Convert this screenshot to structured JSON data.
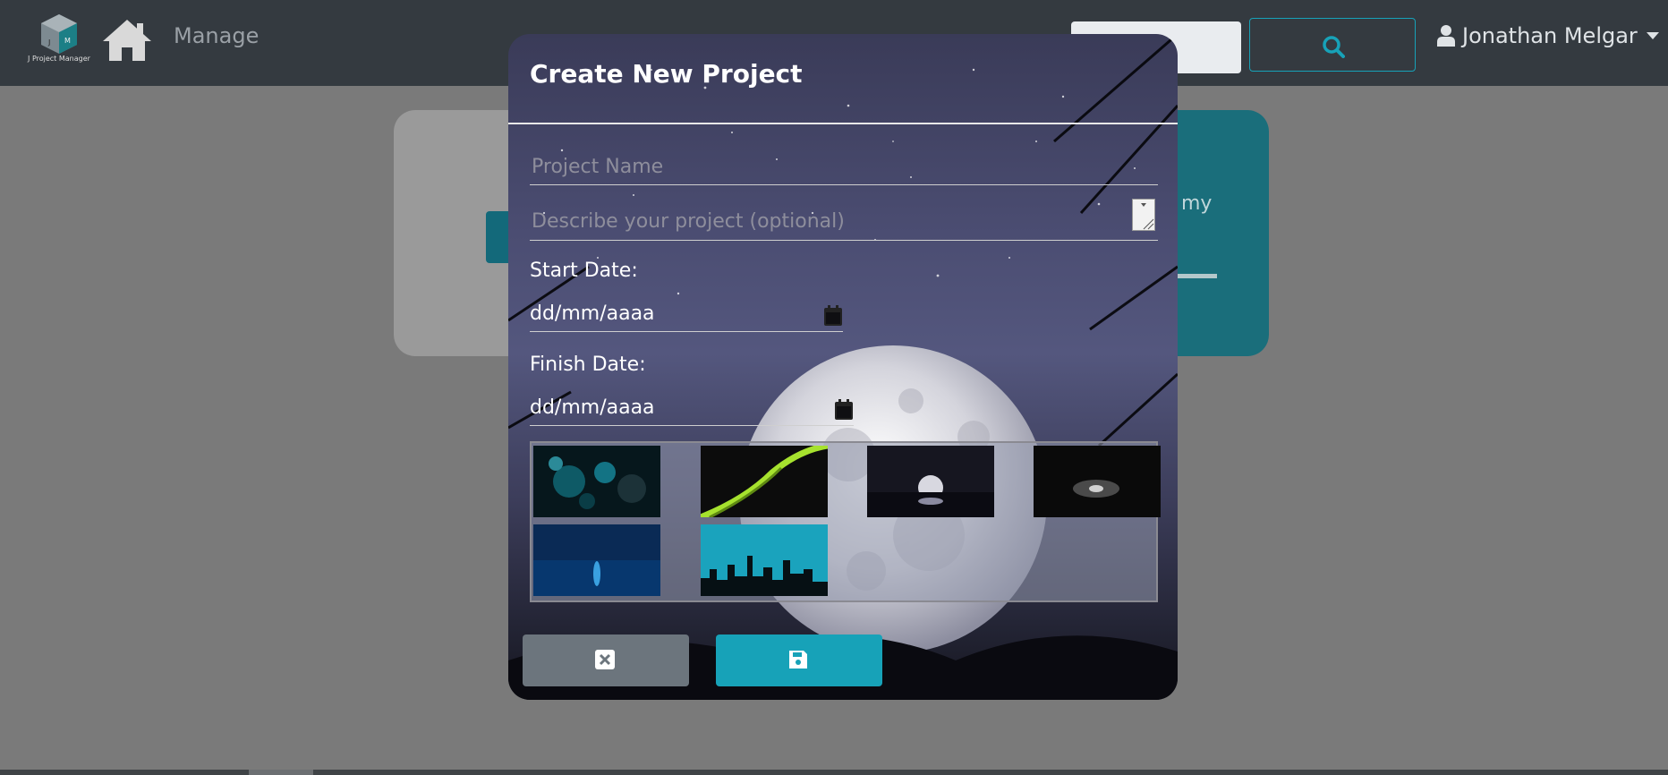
{
  "navbar": {
    "logo_text": "J Project Manager",
    "logo_letters": [
      "J",
      "M"
    ],
    "manage_label": "Manage",
    "search": {
      "placeholder": "",
      "value": ""
    },
    "user_name": "Jonathan Melgar"
  },
  "background": {
    "right_card_text_fragment": "my"
  },
  "modal": {
    "title": "Create New Project",
    "name_placeholder": "Project Name",
    "description_placeholder": "Describe your project (optional)",
    "start_label": "Start Date:",
    "start_value": "dd/mm/aaaa",
    "finish_label": "Finish Date:",
    "finish_value": "dd/mm/aaaa",
    "background_options": [
      "space-asteroids",
      "green-aurora-streak",
      "moon-over-lake",
      "dark-light-glow",
      "blue-night-sea",
      "city-skyline-cyan"
    ]
  },
  "colors": {
    "navbar": "#343a40",
    "accent": "#17a2b8",
    "cancel": "#6c757d",
    "overlay": "#7a7a7a"
  },
  "icons": [
    "home-icon",
    "search-icon",
    "user-icon",
    "calendar-icon",
    "close-icon",
    "save-icon"
  ]
}
